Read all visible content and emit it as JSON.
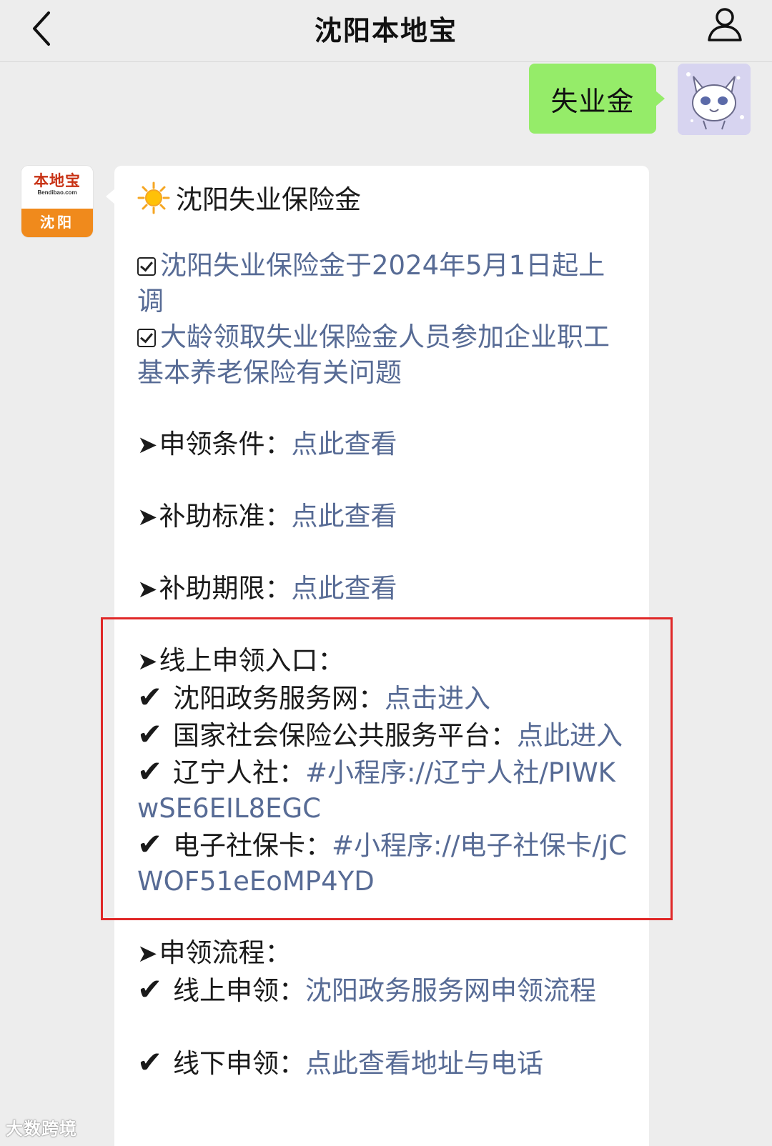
{
  "header": {
    "title": "沈阳本地宝"
  },
  "user_message": {
    "text": "失业金"
  },
  "bot": {
    "avatar_logo_text": "本地宝",
    "avatar_logo_sub": "Bendibao.com",
    "avatar_city": "沈阳",
    "heading": "沈阳失业保险金",
    "news": [
      "沈阳失业保险金于2024年5月1日起上调",
      "大龄领取失业保险金人员参加企业职工基本养老保险有关问题"
    ],
    "items": [
      {
        "label": "申领条件：",
        "link": "点此查看"
      },
      {
        "label": "补助标准：",
        "link": "点此查看"
      },
      {
        "label": "补助期限：",
        "link": "点此查看"
      }
    ],
    "online_section": {
      "title": "线上申领入口：",
      "entries": [
        {
          "label": "沈阳政务服务网：",
          "link": "点击进入"
        },
        {
          "label": "国家社会保险公共服务平台：",
          "link": "点此进入"
        },
        {
          "label": "辽宁人社：",
          "link": "#小程序://辽宁人社/PIWKwSE6EIL8EGC"
        },
        {
          "label": "电子社保卡：",
          "link": "#小程序://电子社保卡/jCWOF51eEoMP4YD"
        }
      ]
    },
    "process_section": {
      "title": "申领流程：",
      "entries": [
        {
          "label": "线上申领：",
          "link": "沈阳政务服务网申领流程"
        },
        {
          "label": "线下申领：",
          "link": "点此查看地址与电话"
        }
      ]
    }
  },
  "watermark": "大数跨境",
  "colors": {
    "link": "#576b95",
    "user_bubble": "#95ec69",
    "highlight": "#e02828",
    "background": "#ededed"
  }
}
